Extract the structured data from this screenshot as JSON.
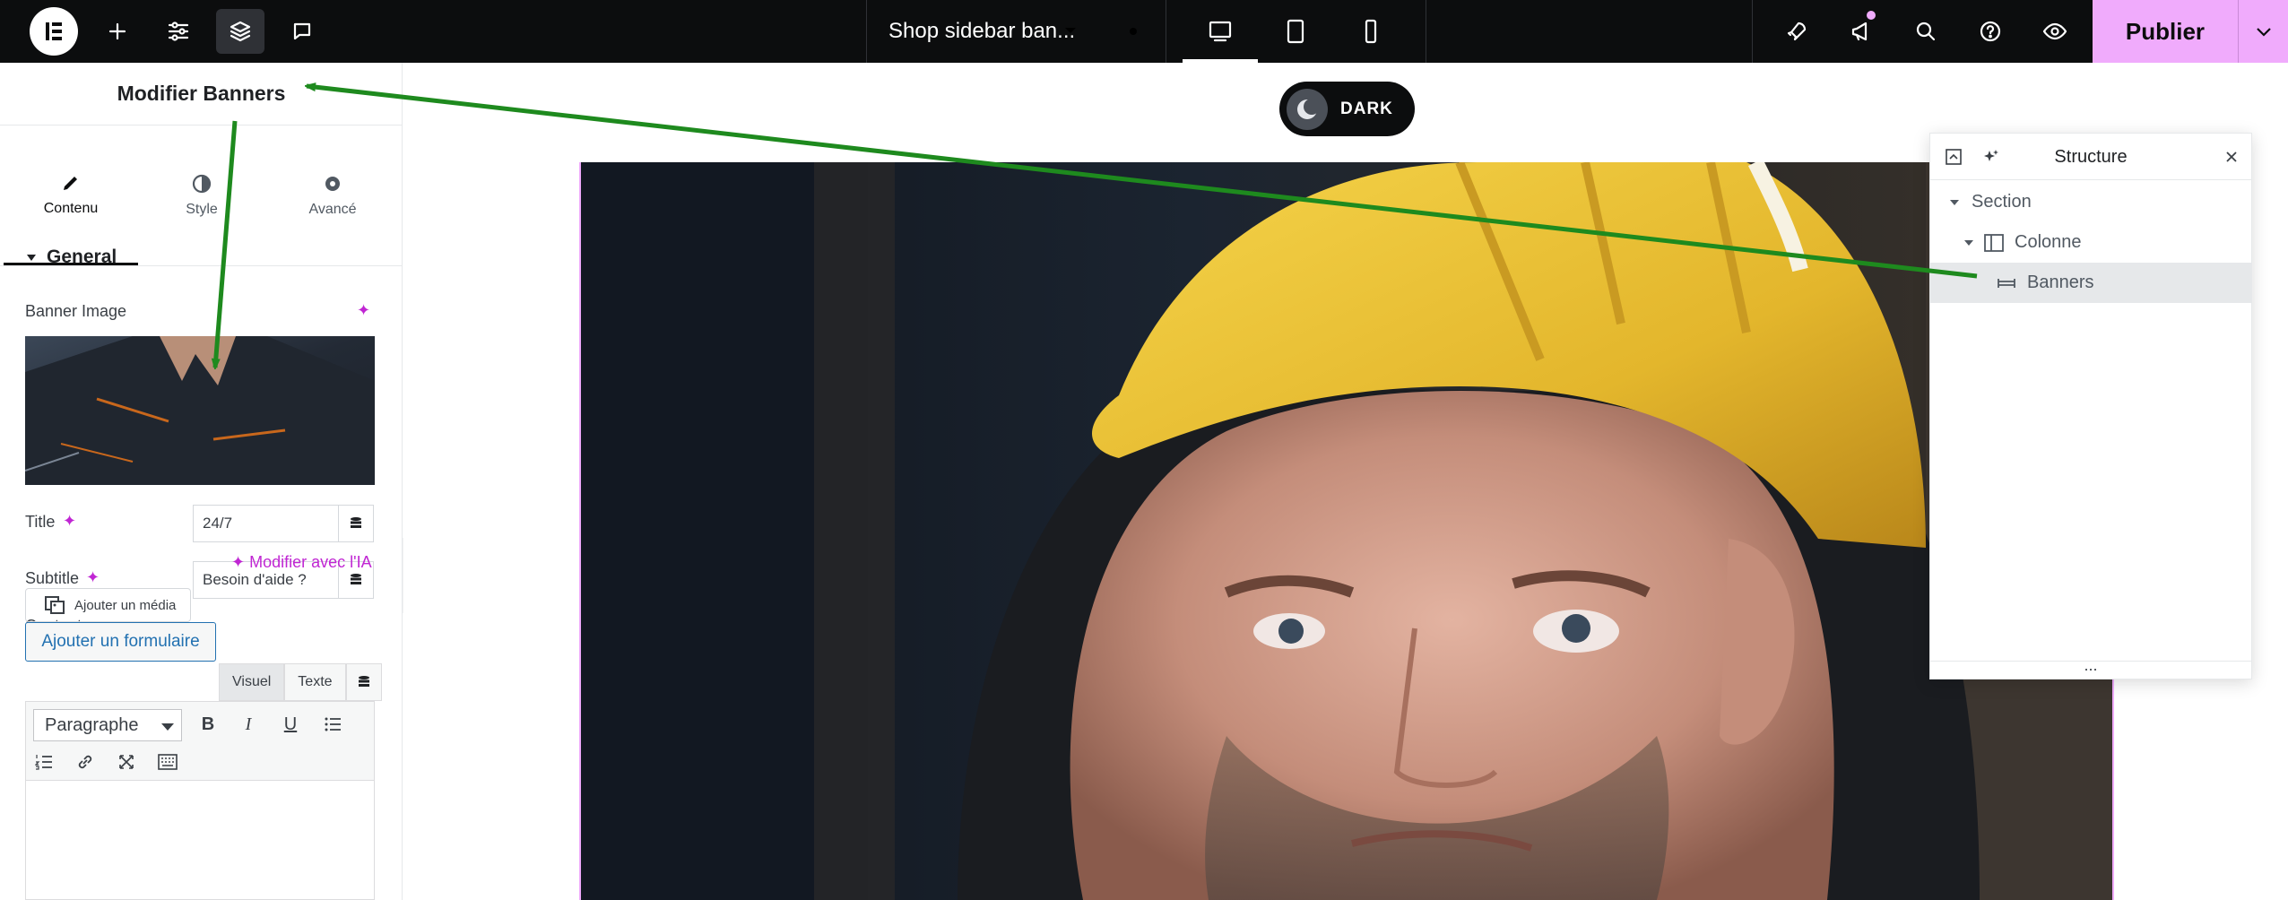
{
  "topbar": {
    "document_title": "Shop sidebar ban...",
    "publish_label": "Publier"
  },
  "panel": {
    "title": "Modifier Banners",
    "tabs": [
      {
        "label": "Contenu",
        "icon": "pencil-icon"
      },
      {
        "label": "Style",
        "icon": "half-circle-icon"
      },
      {
        "label": "Avancé",
        "icon": "gear-icon"
      }
    ],
    "section_title": "General",
    "banner_image_label": "Banner Image",
    "title_label": "Title",
    "title_value": "24/7",
    "subtitle_label": "Subtitle",
    "subtitle_value": "Besoin d'aide ?",
    "content_label": "Content",
    "ai_edit_label": "Modifier avec l'IA",
    "add_media_label": "Ajouter un média",
    "add_form_label": "Ajouter un formulaire",
    "editor_tabs": [
      "Visuel",
      "Texte"
    ],
    "paragraph_select": "Paragraphe"
  },
  "canvas": {
    "dark_toggle_label": "DARK"
  },
  "structure": {
    "title": "Structure",
    "items": [
      {
        "label": "Section",
        "level": 0
      },
      {
        "label": "Colonne",
        "level": 1
      },
      {
        "label": "Banners",
        "level": 2,
        "selected": true
      }
    ]
  },
  "colors": {
    "accent_pink": "#f0abfc",
    "ai_magenta": "#c026d3",
    "annotation_arrow": "#1e8a1e",
    "topbar_bg": "#0c0d0e",
    "link_blue": "#2271b1"
  }
}
